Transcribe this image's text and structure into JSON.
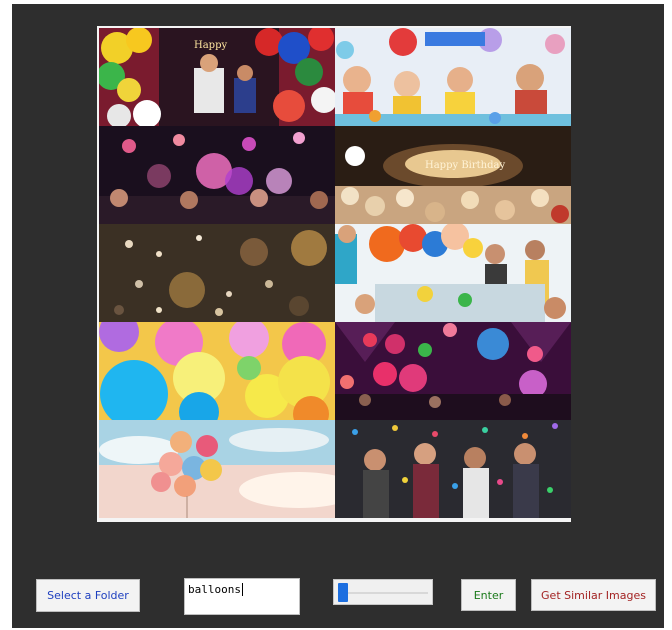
{
  "gallery": {
    "tiles": [
      {
        "name": "tile-birthday-balloons-kids"
      },
      {
        "name": "tile-kids-party-table"
      },
      {
        "name": "tile-party-crowd-purple"
      },
      {
        "name": "tile-happy-birthday-balloon-floor"
      },
      {
        "name": "tile-gold-confetti-balloons"
      },
      {
        "name": "tile-kids-party-colorful-balloons"
      },
      {
        "name": "tile-colorful-balloons-closeup"
      },
      {
        "name": "tile-concert-balloons"
      },
      {
        "name": "tile-balloon-bunch-sky"
      },
      {
        "name": "tile-confetti-crowd"
      }
    ]
  },
  "controls": {
    "select_folder_label": "Select a Folder",
    "search_value": "balloons",
    "slider_value_fraction": 0.0,
    "enter_label": "Enter",
    "similar_label": "Get Similar Images"
  },
  "colors": {
    "window_bg": "#2e2e2e",
    "select_folder_text": "#1e3fbf",
    "enter_text": "#1b7a1b",
    "similar_text": "#a32323",
    "slider_thumb": "#1d6fe0"
  }
}
